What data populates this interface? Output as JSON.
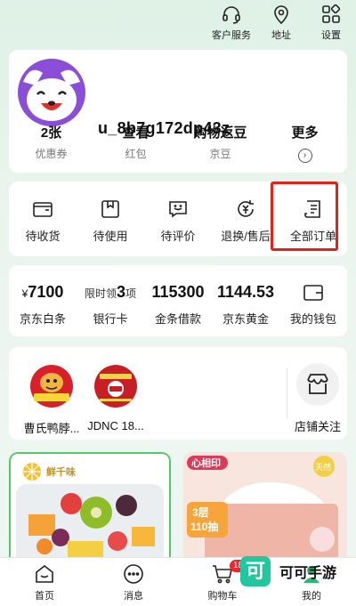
{
  "topnav": {
    "service": "客户服务",
    "address": "地址",
    "settings": "设置"
  },
  "profile": {
    "username": "u_8b7g172dp43z"
  },
  "stats": [
    {
      "value": "2张",
      "label": "优惠券"
    },
    {
      "value": "查看",
      "label": "红包"
    },
    {
      "value": "购物返豆",
      "label": "京豆"
    },
    {
      "value": "更多",
      "label": ""
    }
  ],
  "orders": [
    {
      "label": "待收货",
      "icon": "wallet-box-icon"
    },
    {
      "label": "待使用",
      "icon": "package-icon"
    },
    {
      "label": "待评价",
      "icon": "review-chat-icon"
    },
    {
      "label": "退换/售后",
      "icon": "refund-icon"
    },
    {
      "label": "全部订单",
      "icon": "order-list-icon"
    }
  ],
  "wallet": {
    "baitiao": {
      "prefix": "¥",
      "value": "7100",
      "label": "京东白条"
    },
    "bank": {
      "prefix": "限时领",
      "value": "3",
      "suffix": "项",
      "label": "银行卡"
    },
    "jintiao": {
      "value": "115300",
      "label": "金条借款"
    },
    "gold": {
      "value": "1144.53",
      "label": "京东黄金"
    },
    "mywallet": {
      "label": "我的钱包",
      "icon": "wallet-icon"
    }
  },
  "shops": [
    {
      "name": "曹氏鸭脖..."
    },
    {
      "name": "JDNC 18..."
    }
  ],
  "follow": {
    "label": "店铺关注",
    "icon": "shop-icon"
  },
  "products": {
    "left_brand": "鲜千味",
    "right_brand": "心相印",
    "right_tag1": "3层",
    "right_tag2": "110抽",
    "right_badge": "天然"
  },
  "bottomnav": [
    {
      "label": "首页",
      "icon": "home-icon"
    },
    {
      "label": "消息",
      "icon": "message-icon"
    },
    {
      "label": "购物车",
      "icon": "cart-icon",
      "badge": "18"
    },
    {
      "label": "我的",
      "icon": "profile-icon"
    }
  ],
  "watermark": {
    "glyph": "可",
    "text": "可可手游"
  },
  "colors": {
    "accent": "#e2231a",
    "badge": "#f0252f",
    "watermark": "#22c7a0"
  }
}
